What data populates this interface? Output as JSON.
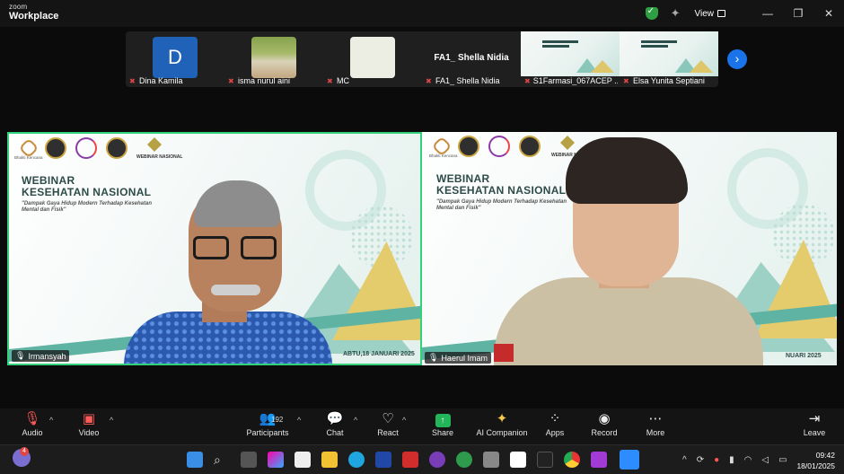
{
  "app": {
    "logo_line1": "zoom",
    "logo_line2": "Workplace",
    "view_label": "View",
    "shield_color": "#2ea043"
  },
  "window_controls": {
    "minimize": "—",
    "maximize": "❐",
    "close": "✕"
  },
  "gallery": [
    {
      "name": "Dina Kamila",
      "kind": "initial",
      "initial": "D",
      "muted": true
    },
    {
      "name": "isma nurul aini",
      "kind": "photo",
      "muted": true
    },
    {
      "name": "MC",
      "kind": "blank",
      "muted": true
    },
    {
      "name": "FA1_ Shella Nidia",
      "kind": "name",
      "muted": true
    },
    {
      "name": "S1Farmasi_067ACEP ...",
      "kind": "slide",
      "muted": true
    },
    {
      "name": "Elsa Yunita Septiani",
      "kind": "slide",
      "muted": true
    }
  ],
  "gallery_next_icon": "›",
  "slide": {
    "org": "Bhakti Kencana",
    "national_label": "WEBINAR NASIONAL",
    "title_line1": "WEBINAR",
    "title_line2": "KESEHATAN NASIONAL",
    "subtitle": "\"Dampak Gaya Hidup Modern Terhadap Kesehatan Mental dan Fisik\"",
    "date_left": "ABTU,18 JANUARI 2025",
    "date_right": "NUARI 2025"
  },
  "speakers": [
    {
      "name": "Irmansyah",
      "active": true
    },
    {
      "name": "Haerul Imam",
      "active": false
    }
  ],
  "toolbar": {
    "audio": "Audio",
    "video": "Video",
    "participants": "Participants",
    "participant_count": "192",
    "chat": "Chat",
    "react": "React",
    "share": "Share",
    "ai": "AI Companion",
    "apps": "Apps",
    "record": "Record",
    "more": "More",
    "leave": "Leave"
  },
  "taskbar": {
    "notification_count": "4",
    "time": "09:42",
    "date": "18/01/2025"
  }
}
